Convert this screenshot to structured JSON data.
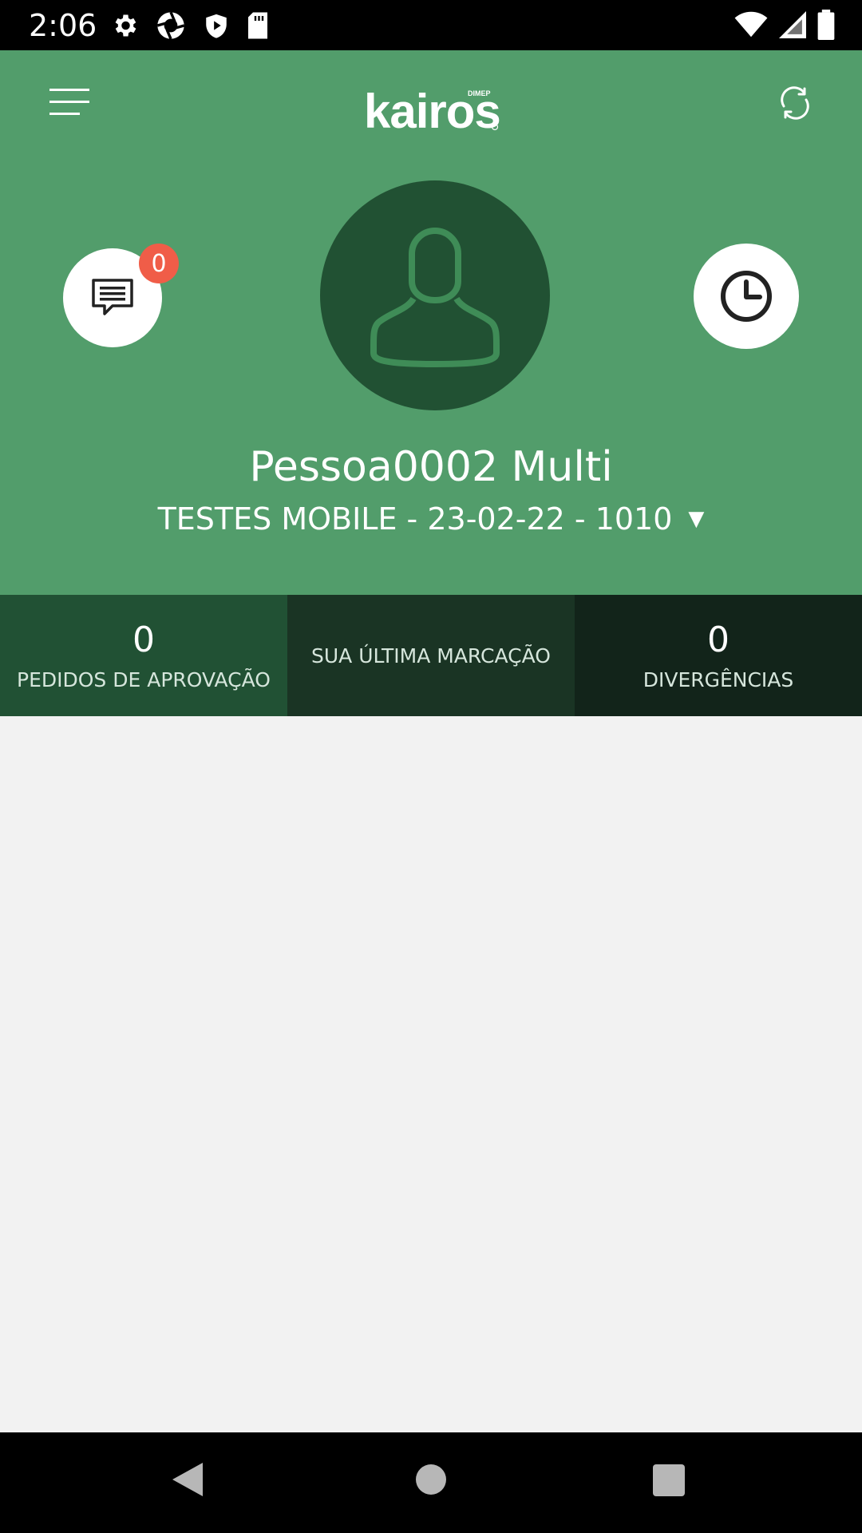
{
  "status_bar": {
    "time": "2:06",
    "left_icons": [
      "gear-icon",
      "aperture-icon",
      "shield-play-icon",
      "sd-card-icon"
    ],
    "right_icons": [
      "wifi-icon",
      "signal-icon",
      "battery-icon"
    ]
  },
  "header": {
    "logo_text": "kairos",
    "logo_sub": "DIMEP",
    "menu_icon": "hamburger-icon",
    "sync_icon": "sync-icon",
    "background_color": "#529d6b"
  },
  "profile": {
    "messages_badge": "0",
    "name": "Pessoa0002 Multi",
    "company": "TESTES MOBILE - 23-02-22 - 1010",
    "company_caret": "▼"
  },
  "summary": {
    "approvals": {
      "value": "0",
      "label": "PEDIDOS DE APROVAÇÃO"
    },
    "last_mark": {
      "label": "SUA ÚLTIMA MARCAÇÃO"
    },
    "divergences": {
      "value": "0",
      "label": "DIVERGÊNCIAS"
    }
  },
  "colors": {
    "badge": "#f05d48",
    "avatar_bg": "#215133",
    "summary_dark": "#12241a"
  }
}
